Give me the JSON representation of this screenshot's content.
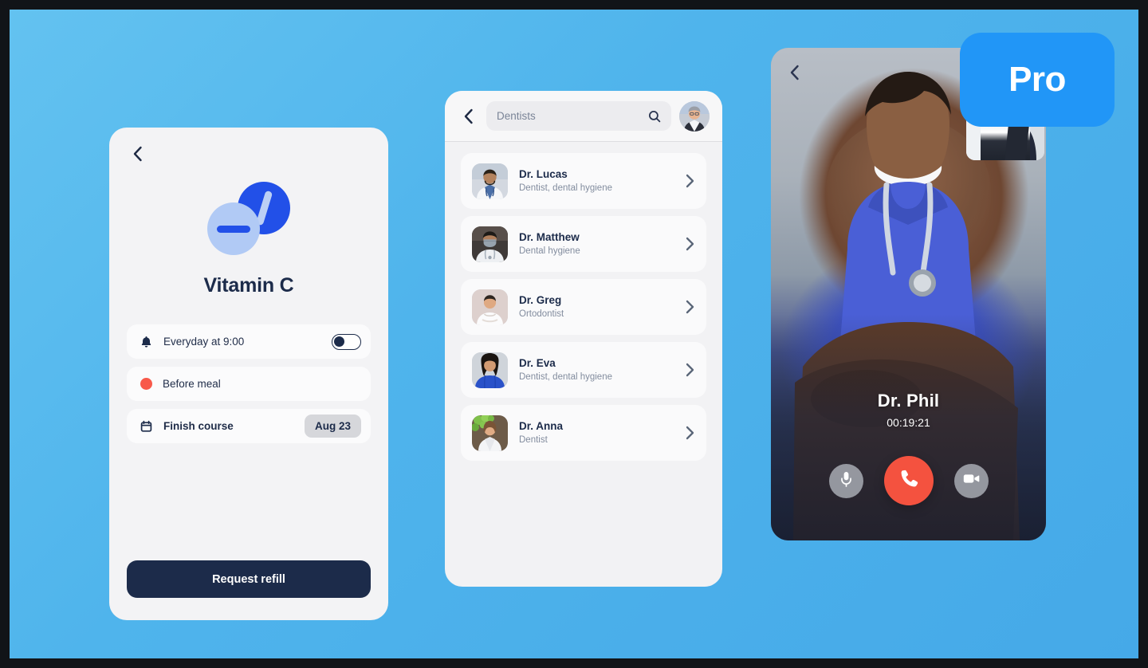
{
  "badge": {
    "label": "Pro",
    "color": "#2196f7"
  },
  "background": {
    "color": "#4fb4ec",
    "frame_color": "#111418"
  },
  "medication_screen": {
    "back_icon": "chevron-left-icon",
    "pill_icon": "pill-capsule-icon",
    "title": "Vitamin C",
    "rows": [
      {
        "icon": "bell-icon",
        "label": "Everyday at 9:00",
        "control": "toggle",
        "toggle_on": false
      },
      {
        "icon": "red-dot-icon",
        "label": "Before meal",
        "control": "none"
      },
      {
        "icon": "calendar-icon",
        "label": "Finish course",
        "control": "badge",
        "badge_value": "Aug 23"
      }
    ],
    "primary_button": "Request refill"
  },
  "doctors_screen": {
    "back_icon": "chevron-left-icon",
    "search": {
      "value": "Dentists",
      "placeholder": "Search",
      "icon": "search-icon"
    },
    "avatar": "user-avatar",
    "list": [
      {
        "name": "Dr. Lucas",
        "specialty": "Dentist, dental hygiene",
        "chevron": "chevron-right-icon"
      },
      {
        "name": "Dr. Matthew",
        "specialty": "Dental hygiene",
        "chevron": "chevron-right-icon"
      },
      {
        "name": "Dr. Greg",
        "specialty": "Ortodontist",
        "chevron": "chevron-right-icon"
      },
      {
        "name": "Dr. Eva",
        "specialty": "Dentist, dental hygiene",
        "chevron": "chevron-right-icon"
      },
      {
        "name": "Dr. Anna",
        "specialty": "Dentist",
        "chevron": "chevron-right-icon"
      }
    ]
  },
  "call_screen": {
    "back_icon": "chevron-left-icon",
    "caller_name": "Dr. Phil",
    "timer": "00:19:21",
    "controls": [
      {
        "name": "mic-button",
        "icon": "microphone-icon",
        "style": "side"
      },
      {
        "name": "end-call-button",
        "icon": "phone-icon",
        "style": "end",
        "color": "#f4523f"
      },
      {
        "name": "video-button",
        "icon": "video-camera-icon",
        "style": "side"
      }
    ]
  }
}
